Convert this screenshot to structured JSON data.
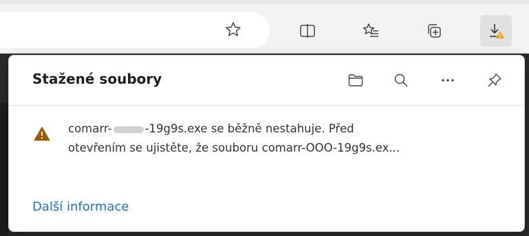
{
  "toolbar": {
    "icons": [
      "favorite-star-icon",
      "split-screen-icon",
      "favorites-list-icon",
      "collections-icon",
      "downloads-warning-icon"
    ]
  },
  "downloads": {
    "title": "Stažené soubory",
    "header_icons": [
      "folder-icon",
      "search-icon",
      "more-icon",
      "pin-icon"
    ],
    "item": {
      "line1_prefix": "comarr-",
      "line1_suffix": "-19g9s.exe se běžně nestahuje. Před",
      "line2": "otevřením se ujistěte, že souboru comarr-OOO-19g9s.ex..."
    },
    "more_info": "Další informace"
  },
  "colors": {
    "warning": "#9a5b00",
    "warning_badge": "#e8a200",
    "link": "#1a73c8"
  }
}
